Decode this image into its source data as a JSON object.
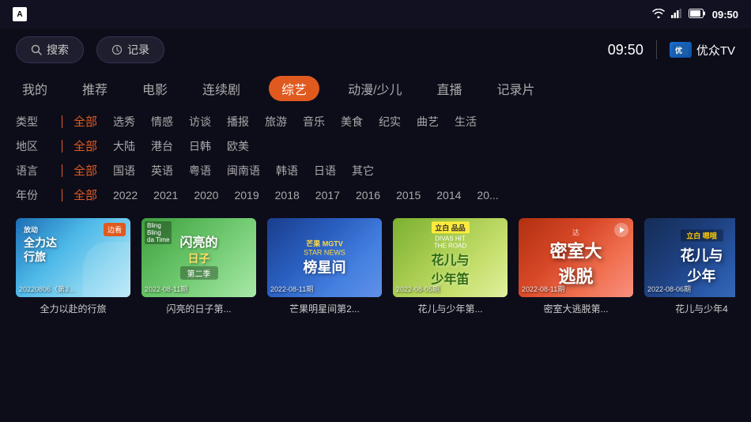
{
  "topbar": {
    "time": "09:50"
  },
  "searchbar": {
    "search_label": "搜索",
    "record_label": "记录",
    "time": "09:50",
    "brand": "优众TV"
  },
  "mainnav": {
    "items": [
      {
        "label": "我的",
        "active": false
      },
      {
        "label": "推荐",
        "active": false
      },
      {
        "label": "电影",
        "active": false
      },
      {
        "label": "连续剧",
        "active": false
      },
      {
        "label": "综艺",
        "active": true
      },
      {
        "label": "动漫/少儿",
        "active": false
      },
      {
        "label": "直播",
        "active": false
      },
      {
        "label": "记录片",
        "active": false
      }
    ]
  },
  "filters": {
    "rows": [
      {
        "label": "类型",
        "items": [
          "全部",
          "选秀",
          "情感",
          "访谈",
          "播报",
          "旅游",
          "音乐",
          "美食",
          "纪实",
          "曲艺",
          "生活"
        ],
        "active_index": 0
      },
      {
        "label": "地区",
        "items": [
          "全部",
          "大陆",
          "港台",
          "日韩",
          "欧美"
        ],
        "active_index": 0
      },
      {
        "label": "语言",
        "items": [
          "全部",
          "国语",
          "英语",
          "粤语",
          "闽南语",
          "韩语",
          "日语",
          "其它"
        ],
        "active_index": 0
      },
      {
        "label": "年份",
        "items": [
          "全部",
          "2022",
          "2021",
          "2020",
          "2019",
          "2018",
          "2017",
          "2016",
          "2015",
          "2014",
          "20..."
        ],
        "active_index": 0
      }
    ]
  },
  "cards": [
    {
      "id": 1,
      "title": "全力达行旅",
      "date": "20220806（第3...",
      "badge": "边看",
      "subtitle": "全力以赴的行旅"
    },
    {
      "id": 2,
      "title": "闪亮的日子第二季",
      "date": "2022-08-11期",
      "badge": "",
      "subtitle": "闪亮的日子第..."
    },
    {
      "id": 3,
      "title": "芒果明星间",
      "date": "2022-08-11期",
      "badge": "",
      "subtitle": "芒果明星间第2..."
    },
    {
      "id": 4,
      "title": "花儿与少年",
      "date": "2022-08-05期",
      "badge": "立白",
      "subtitle": "花儿与少年第..."
    },
    {
      "id": 5,
      "title": "密室大逃脱",
      "date": "2022-08-11期",
      "badge": "",
      "subtitle": "密室大逃脱第..."
    },
    {
      "id": 6,
      "title": "花儿与少年4",
      "date": "2022-08-06期",
      "badge": "立白",
      "subtitle": "花儿与少年4"
    }
  ],
  "colors": {
    "accent": "#e05a20",
    "bg": "#0d0d1a",
    "card_text": "#cccccc"
  }
}
